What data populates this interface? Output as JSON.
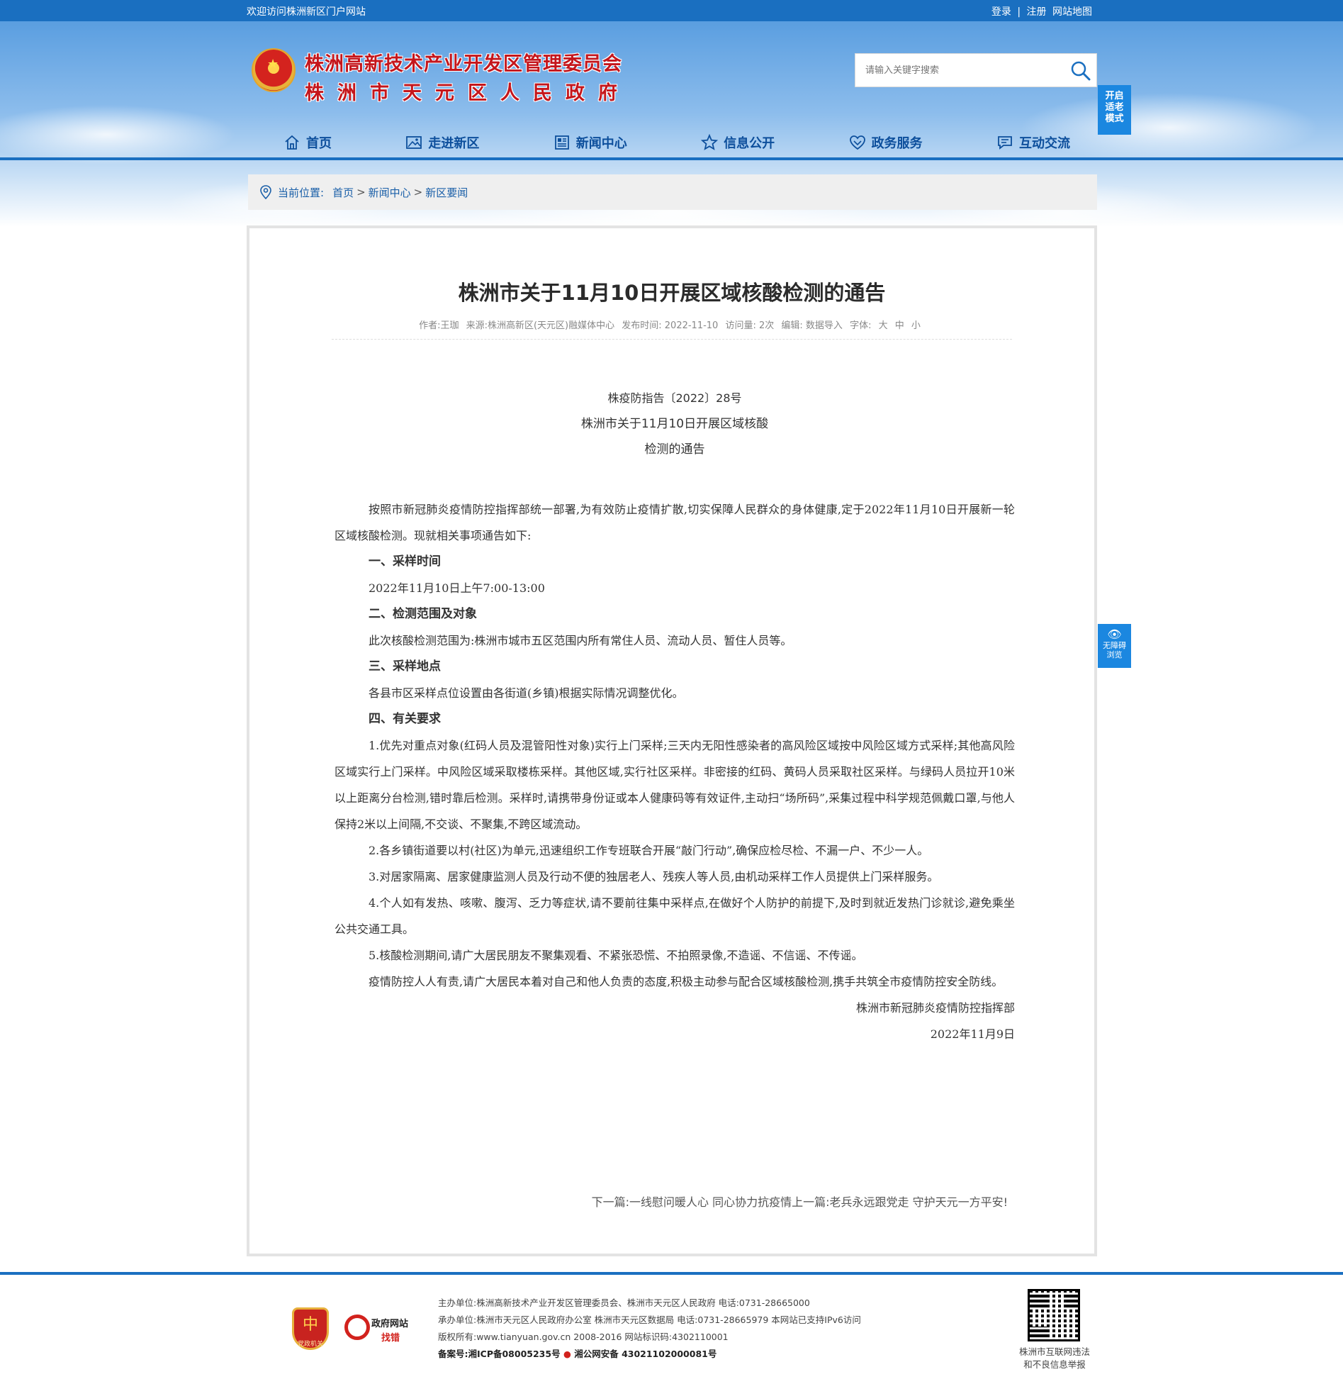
{
  "topbar": {
    "welcome": "欢迎访问株洲新区门户网站",
    "login": "登录",
    "divider": "|",
    "register": "注册",
    "sitemap": "网站地图"
  },
  "header": {
    "org_line1": "株洲高新技术产业开发区管理委员会",
    "org_line2": "株洲市天元区人民政府",
    "search_placeholder": "请输入关键字搜索",
    "elder_mode": [
      "开启",
      "适老",
      "模式"
    ]
  },
  "nav": {
    "items": [
      {
        "label": "首页",
        "icon": "home-icon"
      },
      {
        "label": "走进新区",
        "icon": "picture-icon"
      },
      {
        "label": "新闻中心",
        "icon": "news-icon"
      },
      {
        "label": "信息公开",
        "icon": "star-icon"
      },
      {
        "label": "政务服务",
        "icon": "heart-hands-icon"
      },
      {
        "label": "互动交流",
        "icon": "chat-icon"
      }
    ]
  },
  "breadcrumb": {
    "label": "当前位置:",
    "items": [
      "首页",
      "新闻中心",
      "新区要闻"
    ],
    "sep": ">"
  },
  "article": {
    "title": "株洲市关于11月10日开展区域核酸检测的通告",
    "meta": {
      "author": "作者:王珈",
      "source": "来源:株洲高新区(天元区)融媒体中心",
      "date": "发布时间: 2022-11-10",
      "views": "访问量: 2次",
      "editor": "编辑: 数据导入",
      "font_label": "字体:",
      "font_large": "大",
      "font_medium": "中",
      "font_small": "小"
    },
    "doc_number": "株疫防指告〔2022〕28号",
    "doc_title1": "株洲市关于11月10日开展区域核酸",
    "doc_title2": "检测的通告",
    "paragraphs": [
      "按照市新冠肺炎疫情防控指挥部统一部署,为有效防止疫情扩散,切实保障人民群众的身体健康,定于2022年11月10日开展新一轮区域核酸检测。现就相关事项通告如下:",
      "一、采样时间",
      "2022年11月10日上午7:00-13:00",
      "二、检测范围及对象",
      "此次核酸检测范围为:株洲市城市五区范围内所有常住人员、流动人员、暂住人员等。",
      "三、采样地点",
      "各县市区采样点位设置由各街道(乡镇)根据实际情况调整优化。",
      "四、有关要求",
      "1.优先对重点对象(红码人员及混管阳性对象)实行上门采样;三天内无阳性感染者的高风险区域按中风险区域方式采样;其他高风险区域实行上门采样。中风险区域采取楼栋采样。其他区域,实行社区采样。非密接的红码、黄码人员采取社区采样。与绿码人员拉开10米以上距离分台检测,错时靠后检测。采样时,请携带身份证或本人健康码等有效证件,主动扫“场所码”,采集过程中科学规范佩戴口罩,与他人保持2米以上间隔,不交谈、不聚集,不跨区域流动。",
      "2.各乡镇街道要以村(社区)为单元,迅速组织工作专班联合开展“敲门行动”,确保应检尽检、不漏一户、不少一人。",
      "3.对居家隔离、居家健康监测人员及行动不便的独居老人、残疾人等人员,由机动采样工作人员提供上门采样服务。",
      "4.个人如有发热、咳嗽、腹泻、乏力等症状,请不要前往集中采样点,在做好个人防护的前提下,及时到就近发热门诊就诊,避免乘坐公共交通工具。",
      "5.核酸检测期间,请广大居民朋友不聚集观看、不紧张恐慌、不拍照录像,不造谣、不信谣、不传谣。",
      "疫情防控人人有责,请广大居民本着对自己和他人负责的态度,积极主动参与配合区域核酸检测,携手共筑全市疫情防控安全防线。"
    ],
    "signature": "株洲市新冠肺炎疫情防控指挥部",
    "sign_date": "2022年11月9日",
    "next_label": "下一篇:",
    "next_title": "一线慰问暖人心 同心协力抗疫情",
    "prev_label": "上一篇:",
    "prev_title": "老兵永远跟党走 守护天元一方平安!"
  },
  "accessibility": {
    "line1": "无障碍",
    "line2": "浏览"
  },
  "footer": {
    "party_badge": "党政机关",
    "gov_find_line1": "政府网站",
    "gov_find_line2": "找错",
    "host": "主办单位:株洲高新技术产业开发区管理委员会、株洲市天元区人民政府 电话:0731-28665000",
    "organizer": "承办单位:株洲市天元区人民政府办公室 株洲市天元区数据局 电话:0731-28665979 本网站已支持IPv6访问",
    "copyright": "版权所有:www.tianyuan.gov.cn 2008-2016 网站标识码:4302110001",
    "record": "备案号:湘ICP备08005235号",
    "police_record": "湘公网安备 43021102000081号",
    "report_line1": "株洲市互联网违法",
    "report_line2": "和不良信息举报"
  }
}
